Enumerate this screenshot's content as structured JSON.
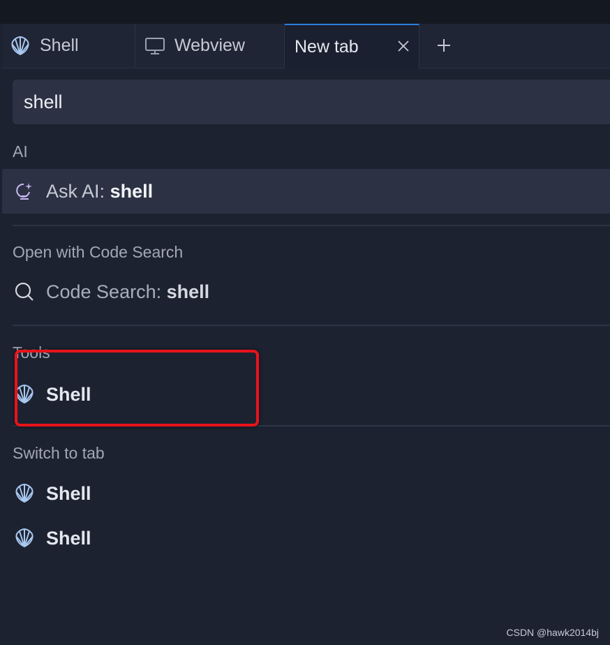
{
  "tabs": [
    {
      "label": "Shell",
      "icon": "shell-icon"
    },
    {
      "label": "Webview",
      "icon": "monitor-icon"
    },
    {
      "label": "New tab",
      "active": true
    }
  ],
  "search": {
    "value": "shell"
  },
  "sections": {
    "ai": {
      "title": "AI",
      "item_prefix": "Ask AI:",
      "item_query": "shell"
    },
    "code_search": {
      "title": "Open with Code Search",
      "item_prefix": "Code Search:",
      "item_query": "shell"
    },
    "tools": {
      "title": "Tools",
      "item_label": "Shell"
    },
    "switch_to_tab": {
      "title": "Switch to tab",
      "items": [
        "Shell",
        "Shell"
      ]
    }
  },
  "watermark": "CSDN @hawk2014bj",
  "colors": {
    "accent": "#2c7fe0",
    "highlight": "#e8141b",
    "icon_blue": "#a9c8f0"
  }
}
